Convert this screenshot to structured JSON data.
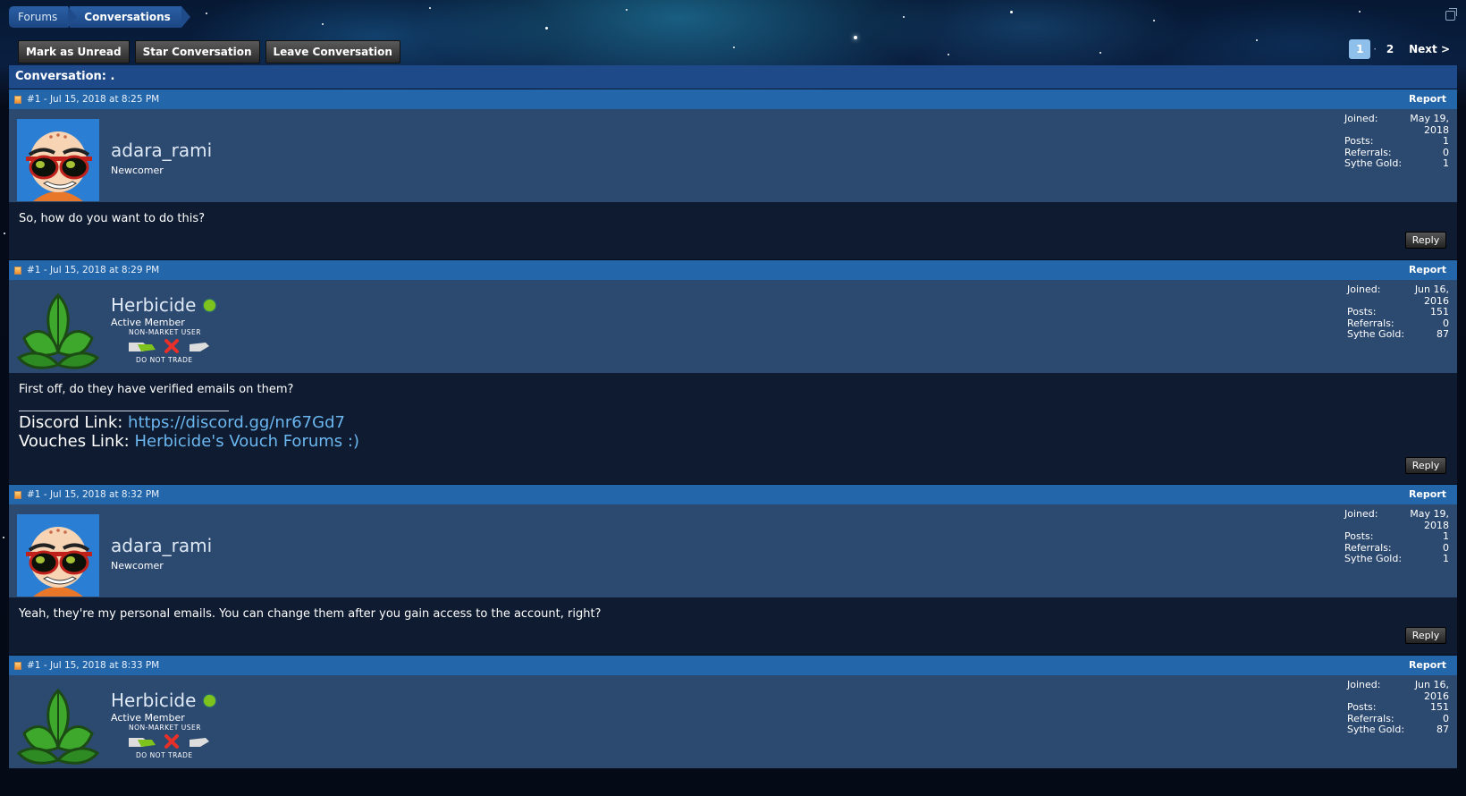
{
  "breadcrumb": [
    "Forums",
    "Conversations"
  ],
  "actions": [
    "Mark as Unread",
    "Star Conversation",
    "Leave Conversation"
  ],
  "pagination": {
    "pages": [
      "1",
      "2"
    ],
    "current": "1",
    "next": "Next >"
  },
  "conversation_title": "Conversation: .",
  "posts": [
    {
      "header": "#1 - Jul 15, 2018 at 8:25 PM",
      "report": "Report",
      "username": "adara_rami",
      "usertitle": "Newcomer",
      "online": false,
      "badges": null,
      "stats": {
        "joined_label": "Joined:",
        "joined": "May 19, 2018",
        "posts_label": "Posts:",
        "posts": "1",
        "referrals_label": "Referrals:",
        "referrals": "0",
        "gold_label": "Sythe Gold:",
        "gold": "1"
      },
      "message": "So, how do you want to do this?",
      "reply": "Reply"
    },
    {
      "header": "#1 - Jul 15, 2018 at 8:29 PM",
      "report": "Report",
      "username": "Herbicide",
      "usertitle": "Active Member",
      "online": true,
      "badges": {
        "top": "NON-MARKET USER",
        "bottom": "DO NOT TRADE"
      },
      "stats": {
        "joined_label": "Joined:",
        "joined": "Jun 16, 2016",
        "posts_label": "Posts:",
        "posts": "151",
        "referrals_label": "Referrals:",
        "referrals": "0",
        "gold_label": "Sythe Gold:",
        "gold": "87"
      },
      "message": "First off, do they have verified emails on them?",
      "signature": {
        "discord_label": "Discord Link: ",
        "discord_link": "https://discord.gg/nr67Gd7",
        "vouches_label": "Vouches Link: ",
        "vouches_link": "Herbicide's Vouch Forums :)"
      },
      "reply": "Reply"
    },
    {
      "header": "#1 - Jul 15, 2018 at 8:32 PM",
      "report": "Report",
      "username": "adara_rami",
      "usertitle": "Newcomer",
      "online": false,
      "badges": null,
      "stats": {
        "joined_label": "Joined:",
        "joined": "May 19, 2018",
        "posts_label": "Posts:",
        "posts": "1",
        "referrals_label": "Referrals:",
        "referrals": "0",
        "gold_label": "Sythe Gold:",
        "gold": "1"
      },
      "message": "Yeah, they're my personal emails. You can change them after you gain access to the account, right?",
      "reply": "Reply"
    },
    {
      "header": "#1 - Jul 15, 2018 at 8:33 PM",
      "report": "Report",
      "username": "Herbicide",
      "usertitle": "Active Member",
      "online": true,
      "badges": {
        "top": "NON-MARKET USER",
        "bottom": "DO NOT TRADE"
      },
      "stats": {
        "joined_label": "Joined:",
        "joined": "Jun 16, 2016",
        "posts_label": "Posts:",
        "posts": "151",
        "referrals_label": "Referrals:",
        "referrals": "0",
        "gold_label": "Sythe Gold:",
        "gold": "87"
      }
    }
  ],
  "icons": {
    "avatar_adara": "cartoon-bald-man-sunglasses-avatar",
    "avatar_herbicide": "green-leaf-avatar",
    "post_icon": "document-icon",
    "popout": "popout-window-icon",
    "badge_handshake": "handshake-icon",
    "badge_x": "red-x-icon"
  },
  "colors": {
    "header_bar": "#2466aa",
    "title_bar": "#1e4a8a",
    "user_panel": "#2c4970",
    "body_panel": "#0e1b30",
    "link": "#6cb7f0",
    "online": "#7ec21e",
    "active_page": "#8fc0ec"
  }
}
